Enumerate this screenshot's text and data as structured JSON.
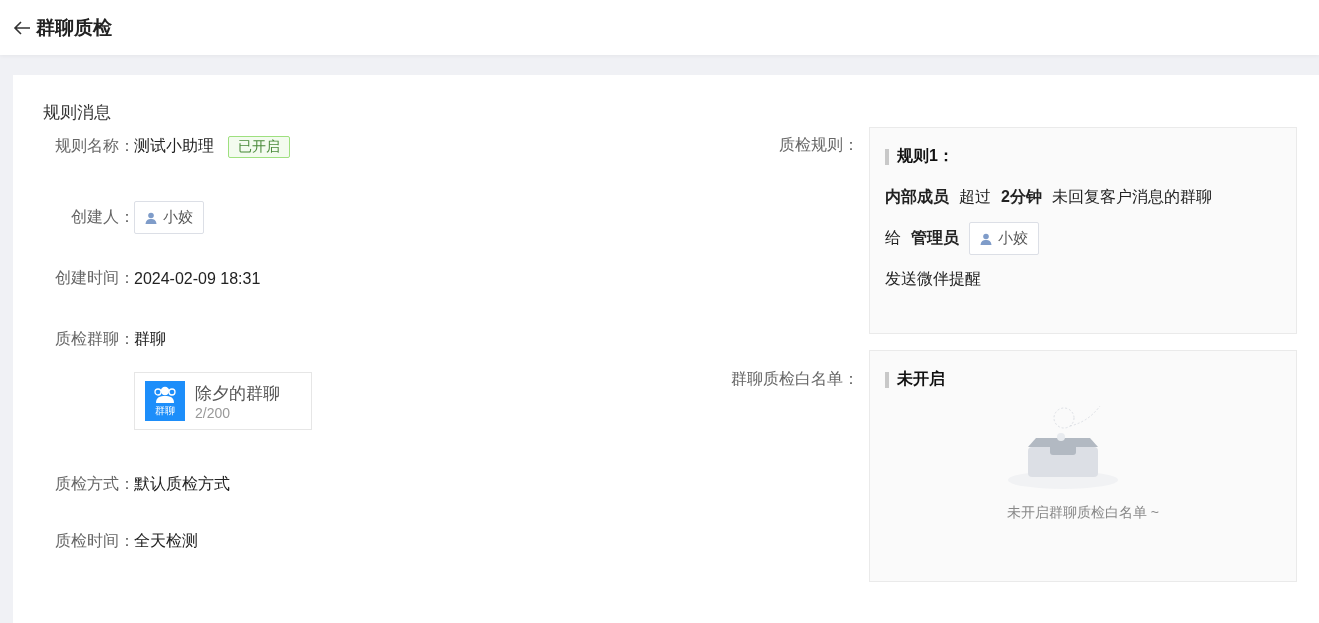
{
  "header": {
    "title": "群聊质检"
  },
  "section_title": "规则消息",
  "fields": [
    {
      "kind": "tag",
      "label": "规则名称：",
      "value": "测试小助理",
      "tag": {
        "text": "已开启",
        "on": true
      }
    },
    {
      "kind": "person",
      "label": "创建人：",
      "value": "小姣"
    },
    {
      "kind": "text",
      "label": "创建时间：",
      "value": "2024-02-09 18:31"
    },
    {
      "kind": "group",
      "label": "质检群聊：",
      "value": "群聊",
      "group": {
        "icon_label": "群聊",
        "name": "除夕的群聊",
        "count": "2/200"
      }
    },
    {
      "kind": "text",
      "label": "质检方式：",
      "value": "默认质检方式"
    },
    {
      "kind": "text",
      "label": "质检时间：",
      "value": "全天检测"
    }
  ],
  "rule": {
    "label": "质检规则：",
    "title": "规则1：",
    "lines": [
      [
        {
          "kind": "text",
          "text": "内部成员",
          "bold": true
        },
        {
          "kind": "text",
          "text": "超过",
          "bold": false
        },
        {
          "kind": "text",
          "text": "2分钟",
          "bold": true
        },
        {
          "kind": "text",
          "text": "未回复客户消息的群聊",
          "bold": false
        }
      ],
      [
        {
          "kind": "text",
          "text": "给",
          "bold": false
        },
        {
          "kind": "text",
          "text": "管理员",
          "bold": true
        },
        {
          "kind": "person",
          "text": "小姣"
        }
      ],
      [
        {
          "kind": "text",
          "text": "发送微伴提醒",
          "bold": false
        }
      ]
    ]
  },
  "whitelist": {
    "label": "群聊质检白名单：",
    "status": "未开启",
    "empty_text": "未开启群聊质检白名单 ~"
  }
}
